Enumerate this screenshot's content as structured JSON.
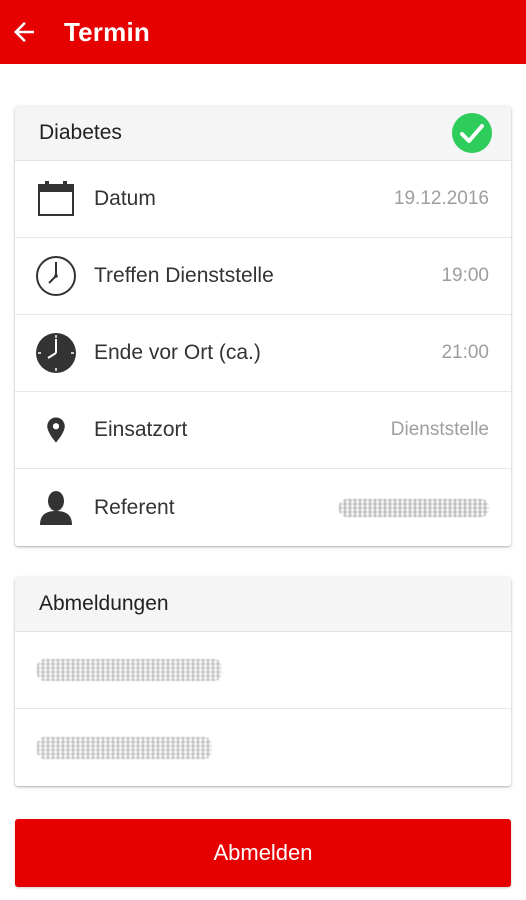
{
  "appbar": {
    "title": "Termin",
    "color": "#e60000"
  },
  "card": {
    "title": "Diabetes",
    "rows": [
      {
        "icon": "calendar-icon",
        "label": "Datum",
        "value": "19.12.2016"
      },
      {
        "icon": "clock-outline-icon",
        "label": "Treffen Dienststelle",
        "value": "19:00"
      },
      {
        "icon": "clock-filled-icon",
        "label": "Ende vor Ort (ca.)",
        "value": "21:00"
      },
      {
        "icon": "location-pin-icon",
        "label": "Einsatzort",
        "value": "Dienststelle"
      },
      {
        "icon": "person-icon",
        "label": "Referent",
        "value": ""
      }
    ]
  },
  "abmeldungen": {
    "title": "Abmeldungen"
  },
  "button": {
    "label": "Abmelden"
  }
}
